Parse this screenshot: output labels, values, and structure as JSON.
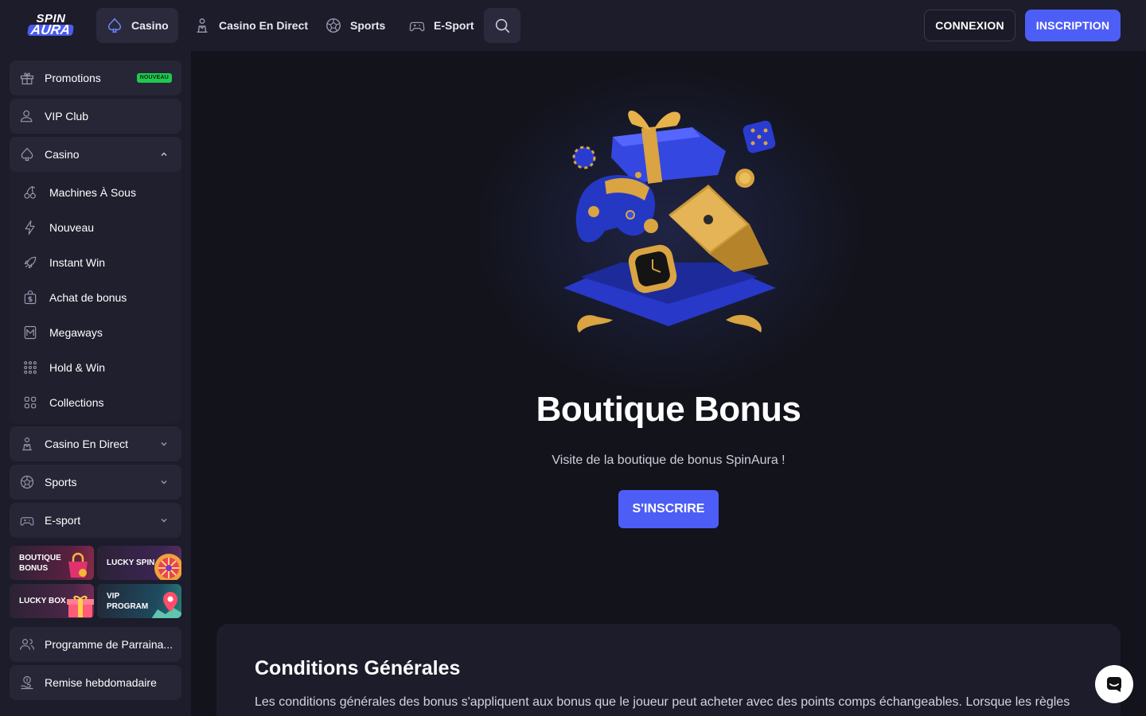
{
  "header": {
    "logo_line1": "SPIN",
    "logo_line2": "AURA",
    "tabs": [
      {
        "label": "Casino",
        "icon": "spade-icon",
        "active": true
      },
      {
        "label": "Casino En Direct",
        "icon": "dealer-icon"
      },
      {
        "label": "Sports",
        "icon": "soccer-ball-icon"
      },
      {
        "label": "E-Sport",
        "icon": "gamepad-icon"
      }
    ],
    "login_label": "CONNEXION",
    "signup_label": "INSCRIPTION"
  },
  "sidebar": {
    "promotions": {
      "label": "Promotions",
      "badge": "NOUVEAU",
      "icon": "gift-icon"
    },
    "vip": {
      "label": "VIP Club",
      "icon": "user-icon"
    },
    "casino": {
      "label": "Casino",
      "icon": "spade-icon",
      "expanded": true,
      "items": [
        {
          "label": "Machines À Sous",
          "icon": "cherries-icon"
        },
        {
          "label": "Nouveau",
          "icon": "lightning-icon"
        },
        {
          "label": "Instant Win",
          "icon": "rocket-icon"
        },
        {
          "label": "Achat de bonus",
          "icon": "bonus-bag-icon"
        },
        {
          "label": "Megaways",
          "icon": "megaways-icon"
        },
        {
          "label": "Hold & Win",
          "icon": "dots-grid-icon"
        },
        {
          "label": "Collections",
          "icon": "squares-grid-icon"
        }
      ]
    },
    "live_casino": {
      "label": "Casino En Direct",
      "icon": "dealer-icon"
    },
    "sports": {
      "label": "Sports",
      "icon": "soccer-ball-icon"
    },
    "esport": {
      "label": "E-sport",
      "icon": "gamepad-icon"
    },
    "tiles": [
      {
        "label": "BOUTIQUE BONUS",
        "color": "#7a1f3a"
      },
      {
        "label": "LUCKY SPIN",
        "color": "#4a2456"
      },
      {
        "label": "LUCKY BOX",
        "color": "#6a2a52"
      },
      {
        "label": "VIP PROGRAM",
        "color": "#1f5a6a"
      }
    ],
    "referral": {
      "label": "Programme de Parraina...",
      "icon": "users-icon"
    },
    "cashback": {
      "label": "Remise hebdomadaire",
      "icon": "coin-hand-icon"
    }
  },
  "hero": {
    "title": "Boutique Bonus",
    "subtitle": "Visite de la boutique de bonus SpinAura !",
    "cta": "S'INSCRIRE"
  },
  "conditions": {
    "title": "Conditions Générales",
    "text": "Les conditions générales des bonus s'appliquent aux bonus que le joueur peut acheter avec des points comps échangeables. Lorsque les règles"
  },
  "colors": {
    "accent": "#4d5ef7",
    "background": "#13131c",
    "panel": "#1c1c2b",
    "badge": "#1fc94f",
    "gold": "#d9a441"
  }
}
